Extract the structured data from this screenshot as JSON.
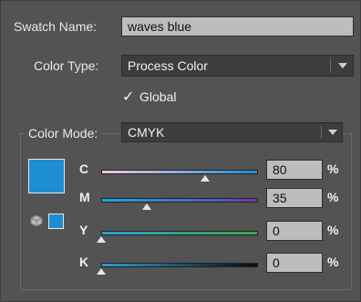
{
  "swatch_name": {
    "label": "Swatch Name:",
    "value": "waves blue"
  },
  "color_type": {
    "label": "Color Type:",
    "value": "Process Color"
  },
  "global": {
    "label": "Global",
    "checked": true,
    "check_glyph": "✓"
  },
  "color_mode": {
    "label": "Color Mode:",
    "value": "CMYK"
  },
  "swatch_color": "#1d8fd0",
  "channels": [
    {
      "label": "C",
      "value": "80",
      "unit": "%",
      "level": 0.8,
      "gradient": [
        "#f3c8e6",
        "#1d8fd0"
      ]
    },
    {
      "label": "M",
      "value": "35",
      "unit": "%",
      "level": 0.35,
      "gradient": [
        "#1aa6e6",
        "#6b3ca8"
      ]
    },
    {
      "label": "Y",
      "value": "0",
      "unit": "%",
      "level": 0.0,
      "gradient": [
        "#2a9fd6",
        "#38a64a"
      ]
    },
    {
      "label": "K",
      "value": "0",
      "unit": "%",
      "level": 0.0,
      "gradient": [
        "#2a9fd6",
        "#0a0a10"
      ]
    }
  ],
  "icons": {
    "gamut": "cube-icon",
    "arrow": "chevron-down-icon"
  }
}
